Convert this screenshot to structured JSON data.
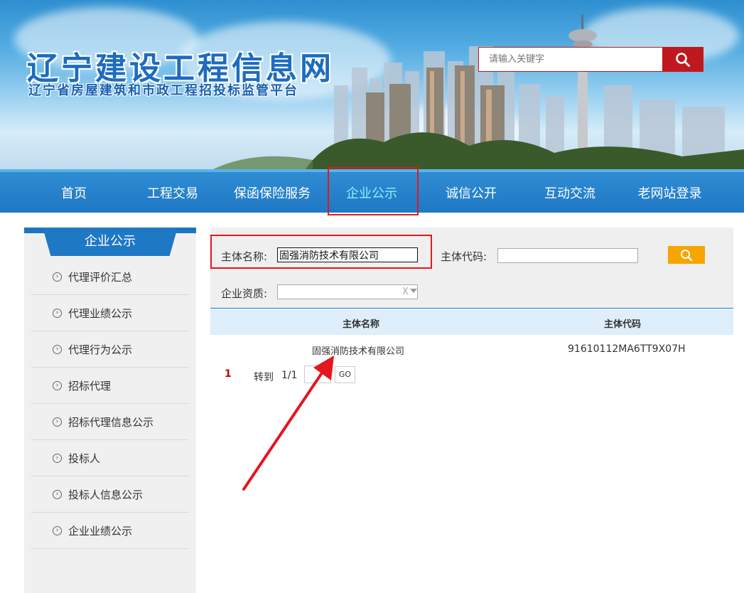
{
  "header": {
    "title": "辽宁建设工程信息网",
    "subtitle": "辽宁省房屋建筑和市政工程招投标监管平台",
    "search_placeholder": "请输入关键字",
    "search_icon": "search-icon"
  },
  "nav": {
    "items": [
      {
        "label": "首页",
        "active": false
      },
      {
        "label": "工程交易",
        "active": false
      },
      {
        "label": "保函保险服务",
        "active": false
      },
      {
        "label": "企业公示",
        "active": true
      },
      {
        "label": "诚信公开",
        "active": false
      },
      {
        "label": "互动交流",
        "active": false
      },
      {
        "label": "老网站登录",
        "active": false
      }
    ],
    "active_color": "#8ff0ff"
  },
  "sidebar": {
    "title": "企业公示",
    "items": [
      {
        "label": "代理评价汇总"
      },
      {
        "label": "代理业绩公示"
      },
      {
        "label": "代理行为公示"
      },
      {
        "label": "招标代理"
      },
      {
        "label": "招标代理信息公示"
      },
      {
        "label": "投标人"
      },
      {
        "label": "投标人信息公示"
      },
      {
        "label": "企业业绩公示"
      }
    ]
  },
  "filters": {
    "name_label": "主体名称:",
    "name_value": "固强消防技术有限公司",
    "code_label": "主体代码:",
    "code_value": "",
    "qualification_label": "企业资质:",
    "qualification_value": "",
    "clear_glyph": "X",
    "query_icon": "search-icon"
  },
  "table": {
    "headers": [
      "主体名称",
      "主体代码"
    ],
    "rows": [
      [
        "固强消防技术有限公司",
        "91610112MA6TT9X07H"
      ]
    ]
  },
  "pager": {
    "current": "1",
    "goto_label": "转到",
    "page_info": "1/1",
    "go_label": "GO"
  },
  "colors": {
    "brand_blue": "#1f78c4",
    "search_red": "#c0181f",
    "query_orange": "#f7a500",
    "annotation_red": "#e4161f"
  }
}
